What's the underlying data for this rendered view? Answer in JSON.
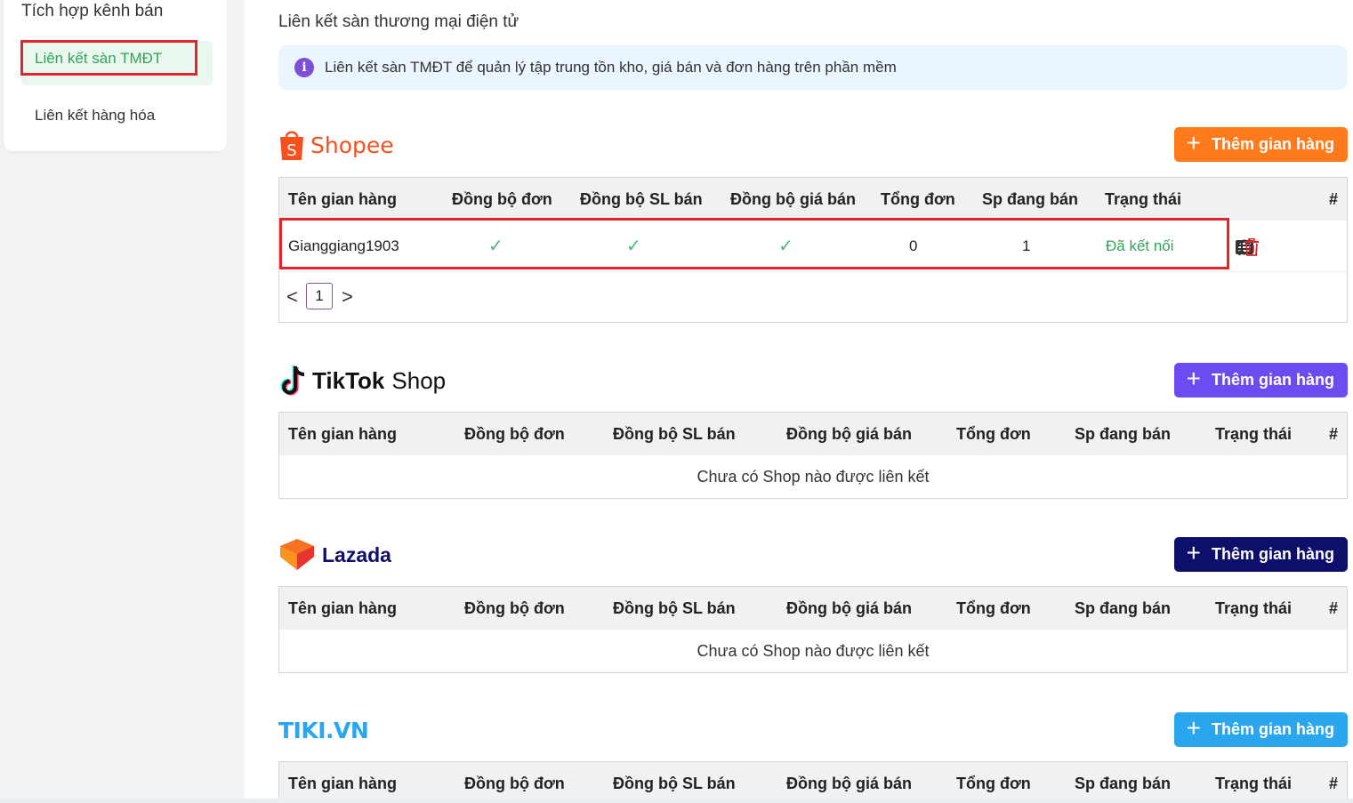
{
  "sidebar": {
    "title": "Tích hợp kênh bán",
    "items": [
      {
        "label": "Liên kết sàn TMĐT",
        "active": true
      },
      {
        "label": "Liên kết hàng hóa",
        "active": false
      }
    ]
  },
  "page": {
    "title": "Liên kết sàn thương mại điện tử",
    "info": "Liên kết sàn TMĐT để quản lý tập trung tồn kho, giá bán và đơn hàng trên phần mềm",
    "info_icon": "i"
  },
  "columns": [
    "Tên gian hàng",
    "Đồng bộ đơn",
    "Đồng bộ SL bán",
    "Đồng bộ giá bán",
    "Tổng đơn",
    "Sp đang bán",
    "Trạng thái",
    "#"
  ],
  "add_label": "Thêm gian hàng",
  "empty_text": "Chưa có Shop nào được liên kết",
  "platforms": {
    "shopee": {
      "name": "Shopee",
      "color": "#ff7a1a",
      "rows": [
        {
          "shop": "Gianggiang1903",
          "sync_orders": "✓",
          "sync_qty": "✓",
          "sync_price": "✓",
          "total_orders": "0",
          "products": "1",
          "status": "Đã kết nối"
        }
      ],
      "pager": {
        "prev": "<",
        "page": "1",
        "next": ">"
      }
    },
    "tiktok": {
      "name_main": "TikTok",
      "name_sub": "Shop",
      "color": "#6c4cf0"
    },
    "lazada": {
      "name": "Lazada",
      "color": "#0d0f6b"
    },
    "tiki": {
      "name": "TIKI.VN",
      "color": "#2aa6ef"
    }
  }
}
